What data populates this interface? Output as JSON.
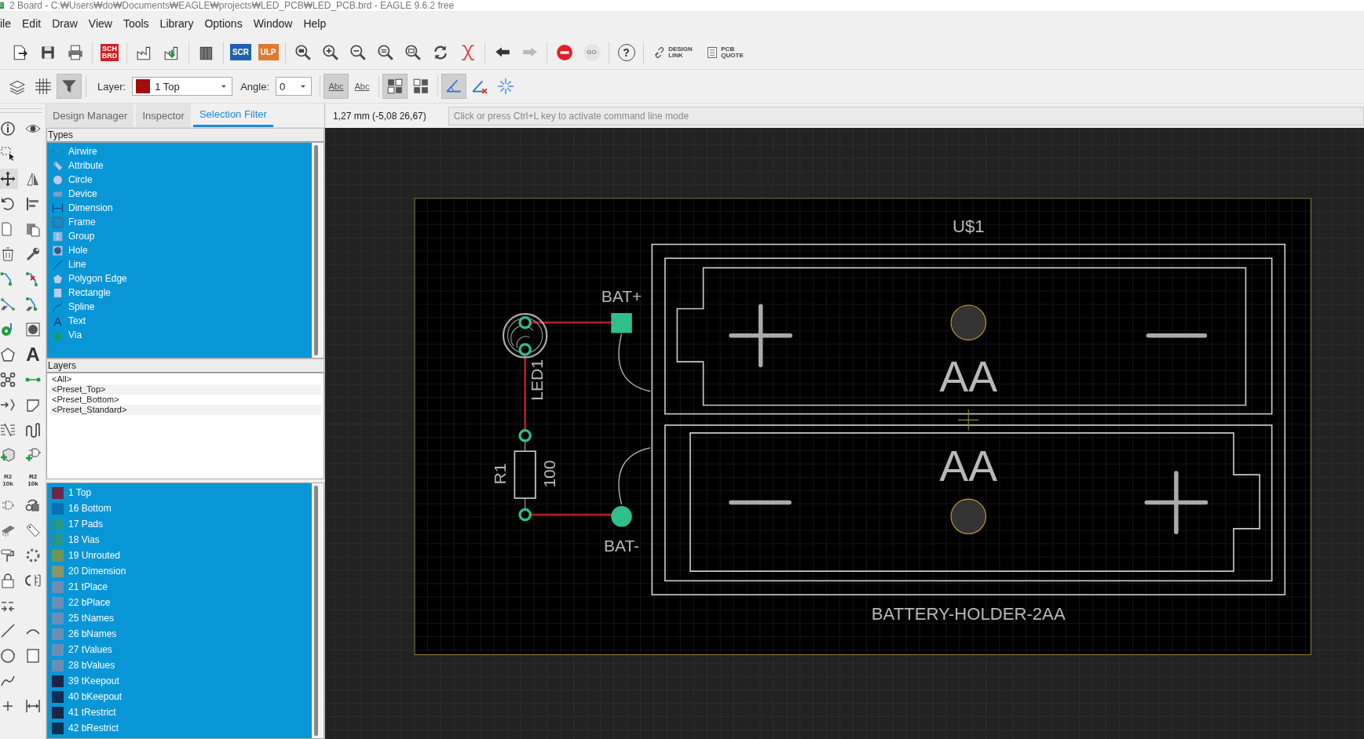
{
  "window": {
    "title": "2 Board - C:₩Users₩do₩Documents₩EAGLE₩projects₩LED_PCB₩LED_PCB.brd - EAGLE 9.6.2 free"
  },
  "menu": [
    "ile",
    "Edit",
    "Draw",
    "View",
    "Tools",
    "Library",
    "Options",
    "Window",
    "Help"
  ],
  "toolbar": [
    {
      "kind": "new"
    },
    {
      "kind": "save"
    },
    {
      "kind": "print"
    },
    {
      "kind": "sep"
    },
    {
      "kind": "schbrd",
      "lines": [
        "SCH",
        "BRD"
      ]
    },
    {
      "kind": "sep"
    },
    {
      "kind": "cam"
    },
    {
      "kind": "camimport"
    },
    {
      "kind": "sep"
    },
    {
      "kind": "library"
    },
    {
      "kind": "sep"
    },
    {
      "kind": "scr",
      "lines": [
        "SCR"
      ]
    },
    {
      "kind": "ulp",
      "lines": [
        "ULP"
      ]
    },
    {
      "kind": "sep"
    },
    {
      "kind": "zoomfit"
    },
    {
      "kind": "zoomin"
    },
    {
      "kind": "zoomout"
    },
    {
      "kind": "zoomsel"
    },
    {
      "kind": "zoomarea"
    },
    {
      "kind": "redraw"
    },
    {
      "kind": "ratsnest"
    },
    {
      "kind": "sep"
    },
    {
      "kind": "undo"
    },
    {
      "kind": "redo",
      "disabled": true
    },
    {
      "kind": "sep"
    },
    {
      "kind": "stop"
    },
    {
      "kind": "go",
      "lines": [
        "GO"
      ],
      "disabled": true
    },
    {
      "kind": "sep"
    },
    {
      "kind": "help",
      "lines": [
        "?"
      ]
    },
    {
      "kind": "sep"
    },
    {
      "kind": "designlink",
      "lines": [
        "DESIGN",
        "LINK"
      ]
    },
    {
      "kind": "pcbquote",
      "lines": [
        "PCB",
        "QUOTE"
      ]
    }
  ],
  "toolbar2": {
    "left": [
      {
        "kind": "layers",
        "pressed": false
      },
      {
        "kind": "grid",
        "pressed": false
      },
      {
        "kind": "filter",
        "pressed": true
      }
    ],
    "layer_label": "Layer:",
    "layer": {
      "color": "#a30d0d",
      "value": "1 Top"
    },
    "angle_label": "Angle:",
    "angle": "0",
    "right": [
      {
        "kind": "abc",
        "text": "Abc",
        "pressed": true
      },
      {
        "kind": "abcmirror",
        "text": "Abc",
        "pressed": false
      },
      {
        "kind": "sep"
      },
      {
        "kind": "layout1",
        "pressed": true
      },
      {
        "kind": "layout2",
        "pressed": false
      },
      {
        "kind": "sep"
      },
      {
        "kind": "angle",
        "pressed": true
      },
      {
        "kind": "angleoff",
        "pressed": false
      },
      {
        "kind": "sparkle",
        "pressed": false
      }
    ]
  },
  "tools": [
    [
      {
        "kind": "info",
        "selected": false
      },
      {
        "kind": "eye",
        "selected": false
      }
    ],
    [
      {
        "kind": "selectrect",
        "selected": false
      }
    ],
    [
      {
        "kind": "move",
        "selected": true
      },
      {
        "kind": "mirror",
        "selected": false
      }
    ],
    [
      {
        "kind": "rotate",
        "selected": false
      },
      {
        "kind": "align",
        "selected": false
      }
    ],
    [
      {
        "kind": "copy",
        "selected": false
      },
      {
        "kind": "paste",
        "selected": false
      }
    ],
    [
      {
        "kind": "delete",
        "selected": false
      },
      {
        "kind": "wrench",
        "selected": false
      }
    ],
    [
      {
        "kind": "route",
        "selected": false
      },
      {
        "kind": "ripup",
        "selected": false
      }
    ],
    [
      {
        "kind": "fanout",
        "selected": false
      },
      {
        "kind": "routeauto",
        "selected": false
      }
    ],
    [
      {
        "kind": "via",
        "selected": false
      },
      {
        "kind": "hole",
        "selected": false
      }
    ],
    [
      {
        "kind": "polygon",
        "selected": false
      },
      {
        "kind": "glyph",
        "text": "A",
        "selected": false
      }
    ],
    [
      {
        "kind": "net",
        "selected": false
      },
      {
        "kind": "airwire",
        "selected": false
      }
    ],
    [
      {
        "kind": "arrowin",
        "selected": false
      },
      {
        "kind": "miter",
        "selected": false
      }
    ],
    [
      {
        "kind": "split",
        "selected": false
      },
      {
        "kind": "meander",
        "selected": false
      }
    ],
    [
      {
        "kind": "addpart",
        "selected": false
      },
      {
        "kind": "addgate",
        "selected": false
      }
    ],
    [
      {
        "kind": "name",
        "lines": [
          "R2",
          "10k"
        ],
        "selected": false
      },
      {
        "kind": "value",
        "lines": [
          "R2",
          "10k"
        ],
        "selected": false
      }
    ],
    [
      {
        "kind": "gate",
        "selected": false
      },
      {
        "kind": "replace",
        "selected": false
      }
    ],
    [
      {
        "kind": "chip",
        "selected": false
      },
      {
        "kind": "tag",
        "selected": false
      }
    ],
    [
      {
        "kind": "paint",
        "selected": false
      },
      {
        "kind": "dots",
        "selected": false
      }
    ],
    [
      {
        "kind": "lock",
        "selected": false
      },
      {
        "kind": "optimize",
        "selected": false
      }
    ],
    [
      {
        "kind": "dash",
        "selected": false
      }
    ],
    [
      {
        "kind": "line",
        "selected": false
      },
      {
        "kind": "arc",
        "selected": false
      }
    ],
    [
      {
        "kind": "circle",
        "selected": false
      },
      {
        "kind": "rect",
        "selected": false
      }
    ],
    [
      {
        "kind": "spline",
        "selected": false
      }
    ],
    [
      {
        "kind": "plus",
        "selected": false
      },
      {
        "kind": "dimension",
        "selected": false
      }
    ]
  ],
  "tabs": [
    {
      "label": "Design Manager",
      "selected": false
    },
    {
      "label": "Inspector",
      "selected": false
    },
    {
      "label": "Selection Filter",
      "selected": true
    }
  ],
  "coordinates": "1,27 mm (-5,08 26,67)",
  "command_line": {
    "placeholder": "Click or press Ctrl+L key to activate command line mode"
  },
  "types": {
    "title": "Types",
    "items": [
      {
        "label": "Airwire",
        "kind": "airwire",
        "selected": true
      },
      {
        "label": "Attribute",
        "kind": "attribute",
        "selected": true
      },
      {
        "label": "Circle",
        "kind": "circle",
        "selected": true
      },
      {
        "label": "Device",
        "kind": "device",
        "selected": true
      },
      {
        "label": "Dimension",
        "kind": "dimension",
        "selected": true
      },
      {
        "label": "Frame",
        "kind": "frame",
        "selected": true
      },
      {
        "label": "Group",
        "kind": "group",
        "selected": true
      },
      {
        "label": "Hole",
        "kind": "hole",
        "selected": true
      },
      {
        "label": "Line",
        "kind": "line",
        "selected": true
      },
      {
        "label": "Polygon Edge",
        "kind": "polygon",
        "selected": true
      },
      {
        "label": "Rectangle",
        "kind": "rectangle",
        "selected": true
      },
      {
        "label": "Spline",
        "kind": "spline",
        "selected": true
      },
      {
        "label": "Text",
        "kind": "text",
        "icon_text": "A",
        "selected": true
      },
      {
        "label": "Via",
        "kind": "via",
        "selected": true
      }
    ]
  },
  "layers": {
    "title": "Layers",
    "presets": [
      "<All>",
      "<Preset_Top>",
      "<Preset_Bottom>",
      "<Preset_Standard>"
    ],
    "items": [
      {
        "label": "1 Top",
        "color": "#6e2846",
        "selected": true
      },
      {
        "label": "16 Bottom",
        "color": "#0b6fb3",
        "selected": true
      },
      {
        "label": "17 Pads",
        "color": "#24978a",
        "selected": true
      },
      {
        "label": "18 Vias",
        "color": "#24978a",
        "selected": true
      },
      {
        "label": "19 Unrouted",
        "color": "#6e9658",
        "selected": true
      },
      {
        "label": "20 Dimension",
        "color": "#8a9468",
        "selected": true
      },
      {
        "label": "21 tPlace",
        "color": "#6a8fb2",
        "selected": true
      },
      {
        "label": "22 bPlace",
        "color": "#6a8fb2",
        "selected": true
      },
      {
        "label": "25 tNames",
        "color": "#6a8fb2",
        "selected": true
      },
      {
        "label": "26 bNames",
        "color": "#6a8fb2",
        "selected": true
      },
      {
        "label": "27 tValues",
        "color": "#6a8fb2",
        "selected": true
      },
      {
        "label": "28 bValues",
        "color": "#6a8fb2",
        "selected": true
      },
      {
        "label": "39 tKeepout",
        "color": "#1a2644",
        "selected": true
      },
      {
        "label": "40 bKeepout",
        "color": "#0c2f52",
        "selected": true
      },
      {
        "label": "41 tRestrict",
        "color": "#1a2644",
        "selected": true
      },
      {
        "label": "42 bRestrict",
        "color": "#0c2f52",
        "selected": true
      }
    ]
  },
  "board": {
    "holder_name": "U$1",
    "holder_value": "BATTERY-HOLDER-2AA",
    "cell_labels": [
      "AA",
      "AA"
    ],
    "pad_labels": [
      "BAT+",
      "BAT-"
    ],
    "led_name": "LED1",
    "resistor_name": "R1",
    "resistor_value": "100"
  }
}
